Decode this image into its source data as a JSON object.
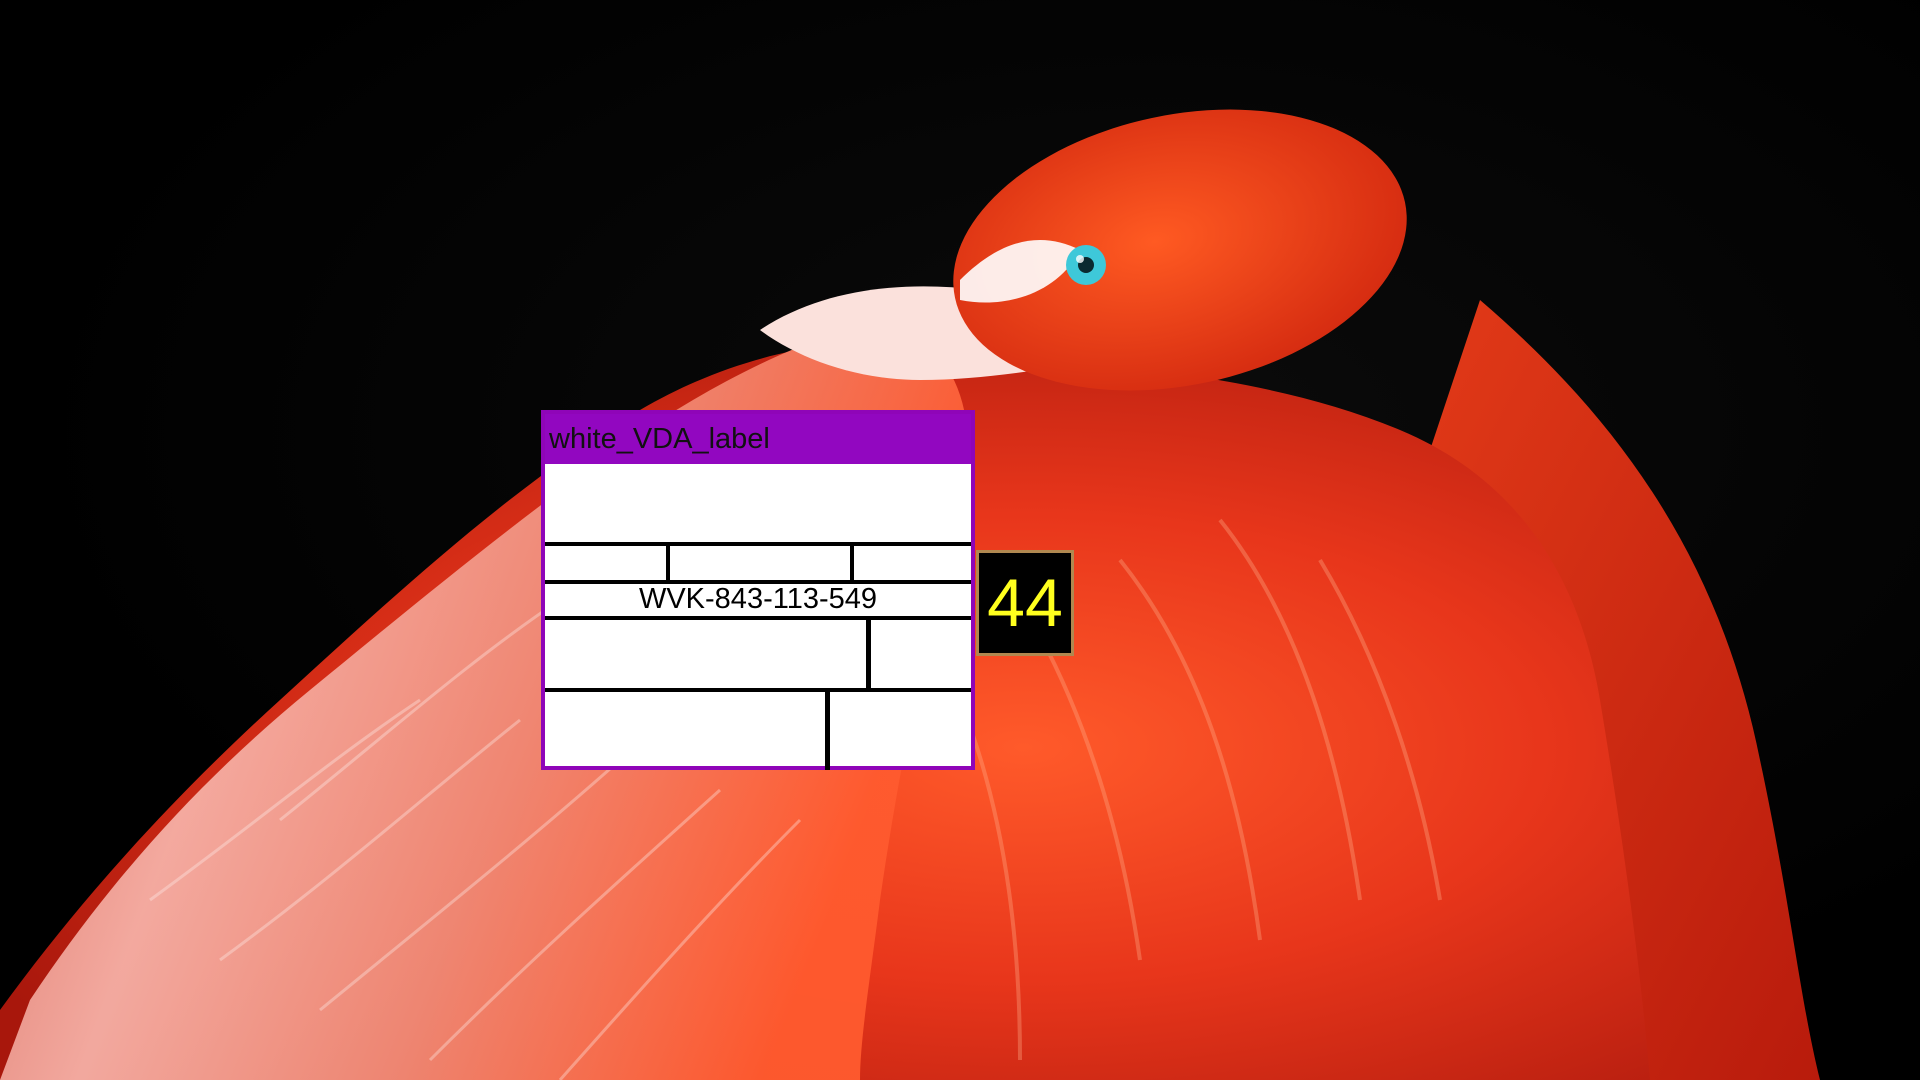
{
  "overlay": {
    "label_title": "white_VDA_label",
    "label_code": "WVK-843-113-549",
    "badge_number": "44"
  },
  "colors": {
    "background": "#000000",
    "label_header": "#9207c0",
    "label_border": "#8f05b8",
    "label_body": "#ffffff",
    "badge_text": "#ffff1e",
    "badge_border": "#b08850",
    "flamingo_red": "#e8361b",
    "flamingo_pink": "#f7b8ae",
    "eye": "#3ec8d9"
  }
}
